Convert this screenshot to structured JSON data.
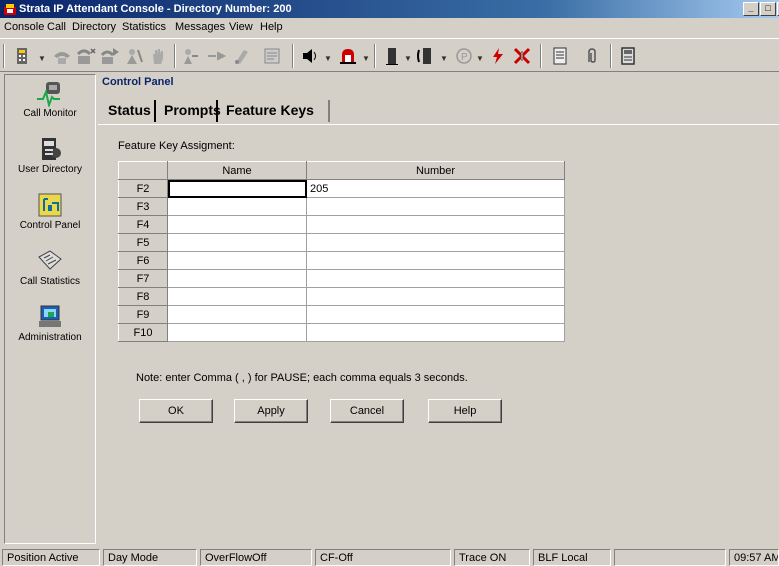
{
  "window": {
    "title": "Strata IP  Attendant Console - Directory Number: 200",
    "min": "_",
    "max": "□",
    "close": "x"
  },
  "menu": [
    "Console",
    "Call",
    "Directory",
    "Statistics",
    "Messages",
    "View",
    "Help"
  ],
  "toolbar_icons": [
    "speed-dial-icon",
    "answer-icon",
    "hold-call-icon",
    "transfer-icon",
    "camp-icon",
    "hand-icon",
    "forward-icon",
    "conference-icon",
    "record-icon",
    "notes-icon",
    "volume-icon",
    "alarm-icon",
    "door-icon",
    "door-open-icon",
    "park-icon",
    "flash-icon",
    "release-icon",
    "notebook-icon",
    "clip-icon",
    "directory-icon"
  ],
  "sidebar": {
    "items": [
      {
        "label": "Call Monitor",
        "icon": "call-monitor-icon"
      },
      {
        "label": "User Directory",
        "icon": "user-directory-icon"
      },
      {
        "label": "Control Panel",
        "icon": "control-panel-icon"
      },
      {
        "label": "Call Statistics",
        "icon": "call-statistics-icon"
      },
      {
        "label": "Administration",
        "icon": "administration-icon"
      }
    ]
  },
  "panel": {
    "header": "Control Panel",
    "tabs": [
      {
        "label": "Status",
        "active": false
      },
      {
        "label": "Prompts",
        "active": false
      },
      {
        "label": "Feature Keys",
        "active": true
      }
    ],
    "assignment_label": "Feature Key Assigment:",
    "table": {
      "columns": [
        "Name",
        "Number"
      ],
      "rows": [
        {
          "key": "F2",
          "name": "",
          "number": "205"
        },
        {
          "key": "F3",
          "name": "",
          "number": ""
        },
        {
          "key": "F4",
          "name": "",
          "number": ""
        },
        {
          "key": "F5",
          "name": "",
          "number": ""
        },
        {
          "key": "F6",
          "name": "",
          "number": ""
        },
        {
          "key": "F7",
          "name": "",
          "number": ""
        },
        {
          "key": "F8",
          "name": "",
          "number": ""
        },
        {
          "key": "F9",
          "name": "",
          "number": ""
        },
        {
          "key": "F10",
          "name": "",
          "number": ""
        }
      ]
    },
    "note": "Note: enter Comma ( , ) for PAUSE; each comma equals 3 seconds.",
    "buttons": {
      "ok": "OK",
      "apply": "Apply",
      "cancel": "Cancel",
      "help": "Help"
    }
  },
  "statusbar": [
    "Position Active",
    "Day Mode",
    "OverFlowOff",
    "CF-Off",
    "Trace ON",
    "BLF Local",
    "",
    "09:57 AM"
  ]
}
